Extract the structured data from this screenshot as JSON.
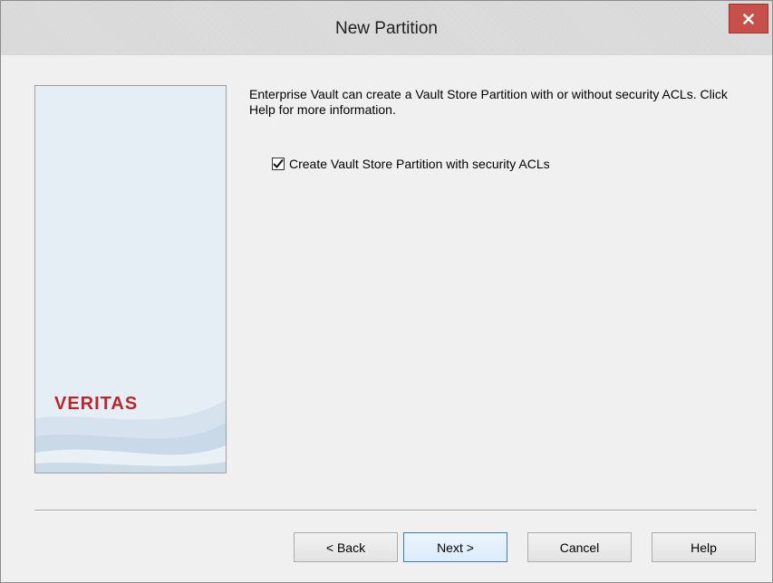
{
  "window": {
    "title": "New Partition",
    "close_label": "x"
  },
  "sidebar": {
    "logo_text": "VERITAS"
  },
  "main": {
    "description": "Enterprise Vault can create a Vault Store Partition with or without security ACLs. Click Help for more information.",
    "checkbox": {
      "label": "Create Vault Store Partition with security ACLs",
      "checked": true
    }
  },
  "buttons": {
    "back": "< Back",
    "next": "Next >",
    "cancel": "Cancel",
    "help": "Help"
  },
  "colors": {
    "close_button": "#c7504a",
    "brand_red": "#b5282e",
    "default_button_border": "#3c7fb1",
    "sidebar_background": "#e6eef5"
  },
  "icons": {
    "close": "close-icon",
    "checkmark": "checkmark-icon"
  }
}
